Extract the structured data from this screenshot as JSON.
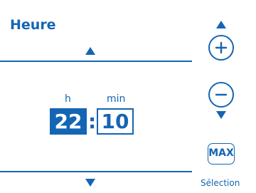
{
  "header": {
    "title": "Heure"
  },
  "time": {
    "hours_label": "h",
    "minutes_label": "min",
    "hours": "22",
    "separator": ":",
    "minutes": "10"
  },
  "controls": {
    "increase_icon": "plus-icon",
    "decrease_icon": "minus-icon",
    "scroll_up_icon": "triangle-up-icon",
    "scroll_down_icon": "triangle-down-icon",
    "max_label": "MAX",
    "selection_label": "Sélection"
  },
  "colors": {
    "accent": "#1465b4",
    "background": "#ffffff"
  }
}
